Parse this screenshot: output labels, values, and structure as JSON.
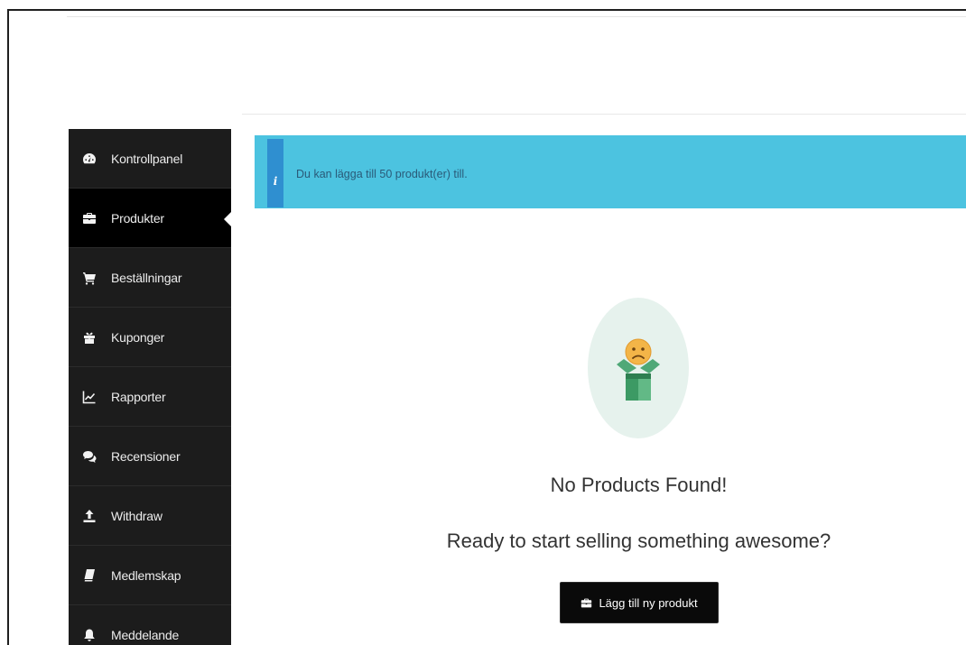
{
  "sidebar": {
    "items": [
      {
        "label": "Kontrollpanel",
        "icon": "dashboard-icon"
      },
      {
        "label": "Produkter",
        "icon": "briefcase-icon",
        "active": true
      },
      {
        "label": "Beställningar",
        "icon": "cart-icon"
      },
      {
        "label": "Kuponger",
        "icon": "gift-icon"
      },
      {
        "label": "Rapporter",
        "icon": "chart-icon"
      },
      {
        "label": "Recensioner",
        "icon": "comments-icon"
      },
      {
        "label": "Withdraw",
        "icon": "upload-icon"
      },
      {
        "label": "Medlemskap",
        "icon": "book-icon"
      },
      {
        "label": "Meddelande",
        "icon": "bell-icon"
      }
    ]
  },
  "alert": {
    "badge": "i",
    "message": "Du kan lägga till 50 produkt(er) till."
  },
  "empty_state": {
    "title": "No Products Found!",
    "subtitle": "Ready to start selling something awesome?",
    "button_label": "Lägg till ny produkt"
  },
  "colors": {
    "sidebar_bg": "#1c1c1c",
    "sidebar_active": "#000000",
    "alert_bg": "#4cc3e0",
    "alert_badge": "#2f8fd0",
    "button_bg": "#0a0a0a"
  }
}
